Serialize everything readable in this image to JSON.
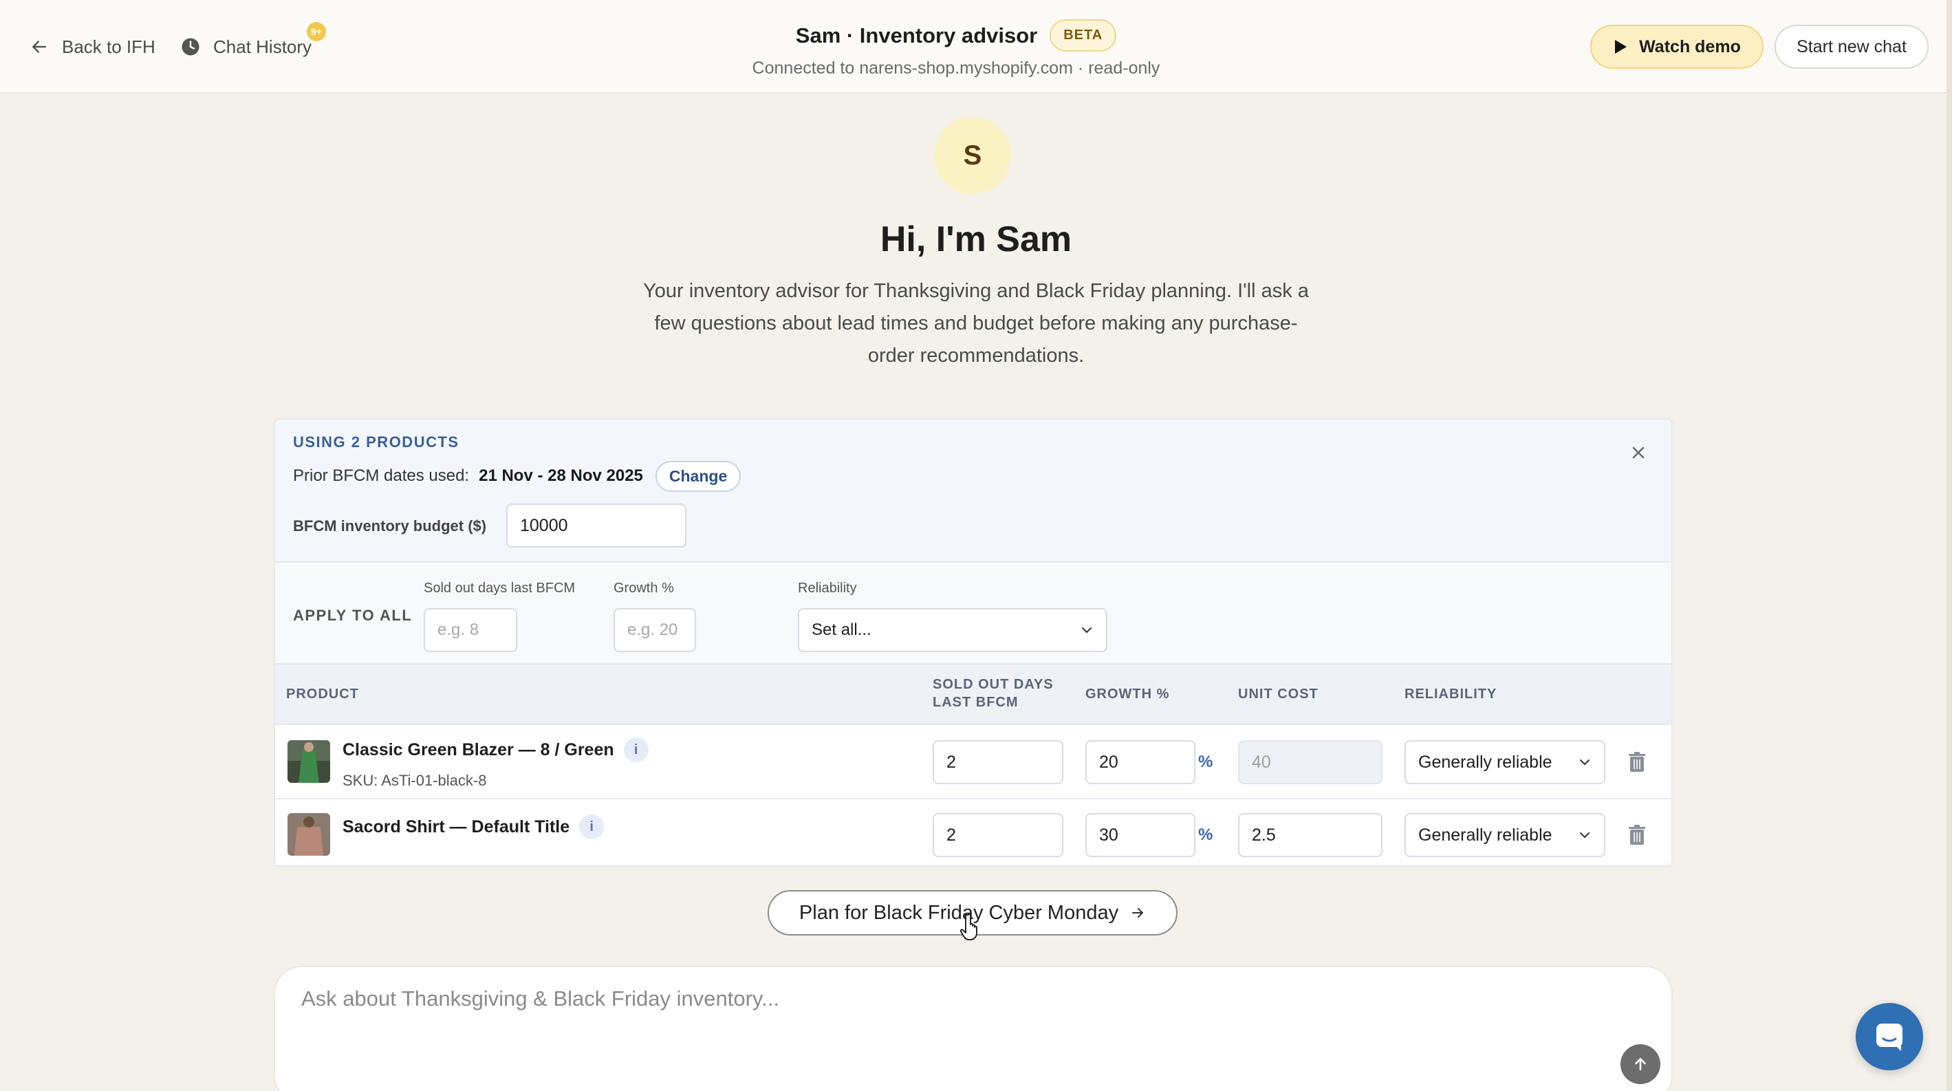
{
  "header": {
    "back_label": "Back to IFH",
    "history_label": "Chat History",
    "history_badge": "9+",
    "title": "Sam · Inventory advisor",
    "beta": "BETA",
    "subtitle": "Connected to narens-shop.myshopify.com · read-only",
    "watch_demo": "Watch demo",
    "start_new_chat": "Start new chat"
  },
  "hero": {
    "avatar_letter": "S",
    "title": "Hi, I'm Sam",
    "description": "Your inventory advisor for Thanksgiving and Black Friday planning. I'll ask a few questions about lead times and budget before making any purchase-order recommendations."
  },
  "card": {
    "heading": "USING 2 PRODUCTS",
    "dates_prefix": "Prior BFCM dates used:",
    "dates_value": "21 Nov - 28 Nov 2025",
    "change_label": "Change",
    "budget_label": "BFCM inventory budget ($)",
    "budget_value": "10000",
    "apply_all": {
      "label": "APPLY TO ALL",
      "sold_out_label": "Sold out days last BFCM",
      "sold_out_placeholder": "e.g. 8",
      "growth_label": "Growth %",
      "growth_placeholder": "e.g. 20",
      "pct": "%",
      "reliability_label": "Reliability",
      "reliability_value": "Set all..."
    },
    "columns": {
      "product": "PRODUCT",
      "sold_out_line1": "SOLD OUT DAYS",
      "sold_out_line2": "LAST BFCM",
      "growth": "GROWTH %",
      "unit_cost": "UNIT COST",
      "reliability": "RELIABILITY"
    },
    "rows": [
      {
        "name": "Classic Green Blazer — 8 / Green",
        "sku": "SKU: AsTi-01-black-8",
        "sold_out": "2",
        "growth": "20",
        "pct": "%",
        "unit_cost": "40",
        "reliability": "Generally reliable",
        "thumb_color": "#2f5a36"
      },
      {
        "name": "Sacord Shirt — Default Title",
        "sold_out": "2",
        "growth": "30",
        "pct": "%",
        "unit_cost": "2.5",
        "reliability": "Generally reliable",
        "thumb_color": "#a07a6c"
      }
    ],
    "info_glyph": "i"
  },
  "plan_button": "Plan for Black Friday Cyber Monday",
  "chat": {
    "placeholder": "Ask about Thanksgiving & Black Friday inventory..."
  },
  "colors": {
    "accent": "#3b5f9a",
    "demo_bg": "#fcefc4",
    "background": "#f4f1ea"
  },
  "icons": [
    "arrow-left-icon",
    "clock-icon",
    "play-icon",
    "close-icon",
    "chevron-down-icon",
    "info-icon",
    "trash-icon",
    "arrow-right-icon",
    "arrow-up-icon",
    "chat-bubble-icon",
    "hand-cursor-icon"
  ]
}
